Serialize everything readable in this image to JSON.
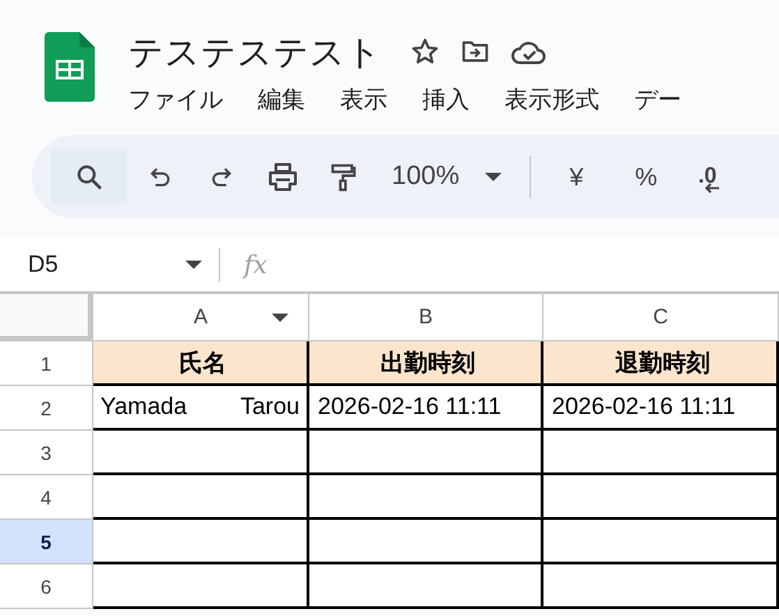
{
  "document": {
    "title": "テステステスト"
  },
  "menu": [
    "ファイル",
    "編集",
    "表示",
    "挿入",
    "表示形式",
    "デー"
  ],
  "toolbar": [
    {
      "kind": "search"
    },
    {
      "kind": "undo"
    },
    {
      "kind": "redo"
    },
    {
      "kind": "print"
    },
    {
      "kind": "paint"
    },
    {
      "kind": "zoom",
      "label": "100%"
    },
    {
      "kind": "separator"
    },
    {
      "kind": "symbol",
      "label": "¥"
    },
    {
      "kind": "symbol",
      "label": "%"
    },
    {
      "kind": "decimal",
      "label": ".0"
    }
  ],
  "name_box": {
    "value": "D5"
  },
  "formula_bar": {
    "label": "fx"
  },
  "sheet": {
    "columns": [
      {
        "label": "A",
        "dropdown": true
      },
      {
        "label": "B",
        "dropdown": false
      },
      {
        "label": "C",
        "dropdown": false
      }
    ],
    "rows": [
      {
        "label": "1",
        "selected": false,
        "kind": "header",
        "cells": [
          "氏名",
          "出勤時刻",
          "退勤時刻"
        ]
      },
      {
        "label": "2",
        "selected": false,
        "kind": "data",
        "cells": [
          "Yamada　Tarou",
          "2026-02-16 11:11",
          "2026-02-16 11:11"
        ]
      },
      {
        "label": "3",
        "selected": false,
        "kind": "data"
      },
      {
        "label": "4",
        "selected": false,
        "kind": "data"
      },
      {
        "label": "5",
        "selected": true,
        "kind": "data"
      },
      {
        "label": "6",
        "selected": false,
        "kind": "data"
      }
    ]
  }
}
